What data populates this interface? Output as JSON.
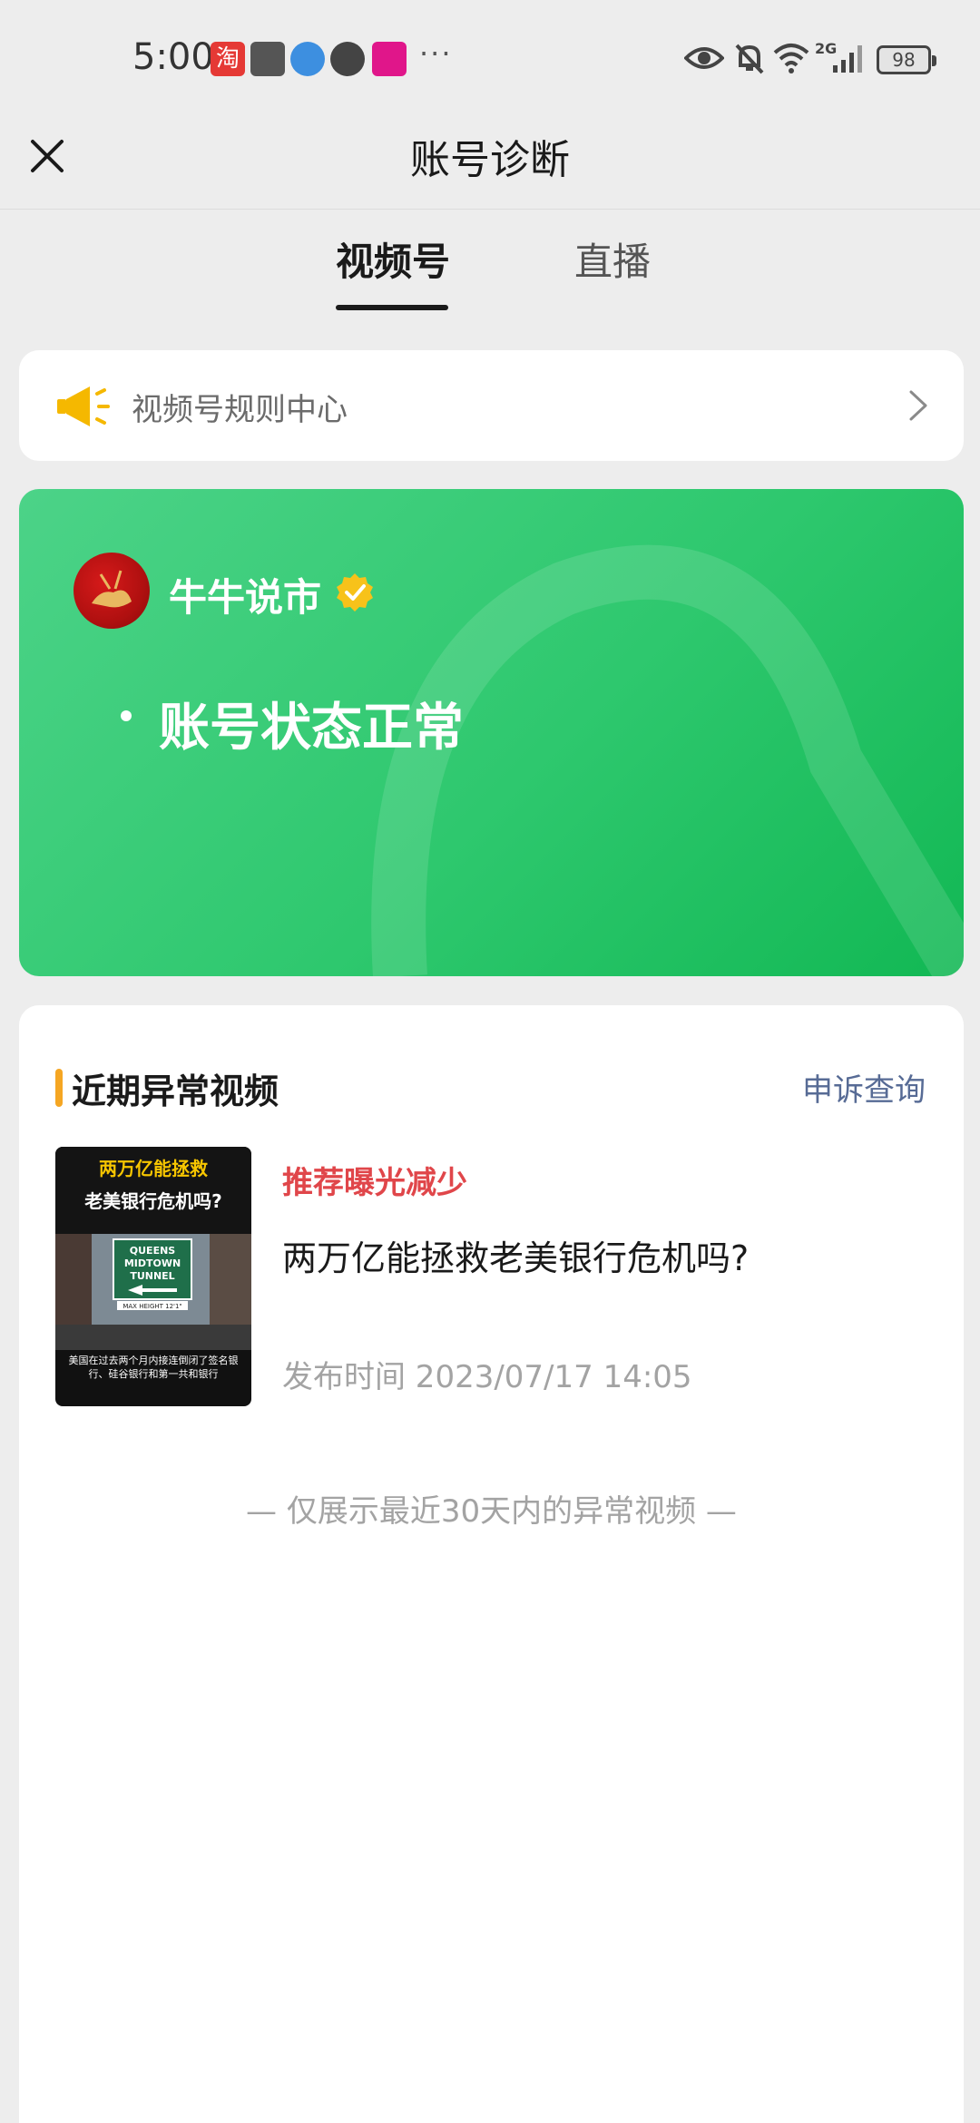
{
  "status_bar": {
    "time": "5:00",
    "more": "···",
    "battery": "98",
    "network": "2G",
    "app_icons": [
      "taobao-icon",
      "mail-icon",
      "browser-icon",
      "wechat-icon",
      "vipshop-icon"
    ],
    "right_icons": [
      "eye-icon",
      "bell-muted-icon",
      "wifi-icon",
      "signal-icon",
      "battery-icon"
    ]
  },
  "header": {
    "title": "账号诊断",
    "close_icon": "close-icon"
  },
  "tabs": [
    {
      "label": "视频号",
      "active": true
    },
    {
      "label": "直播",
      "active": false
    }
  ],
  "rules": {
    "label": "视频号规则中心",
    "icon": "megaphone-icon",
    "chevron": "chevron-right-icon"
  },
  "account": {
    "name": "牛牛说市",
    "status": "账号状态正常",
    "verified_icon": "verified-badge-icon"
  },
  "abnormal": {
    "title": "近期异常视频",
    "appeal": "申诉查询",
    "videos": [
      {
        "tag": "推荐曝光减少",
        "title": "两万亿能拯救老美银行危机吗?",
        "time": "发布时间 2023/07/17 14:05",
        "thumb_line1": "两万亿能拯救",
        "thumb_line2": "老美银行危机吗?",
        "thumb_sign1": "QUEENS",
        "thumb_sign2": "MIDTOWN",
        "thumb_sign3": "TUNNEL",
        "thumb_sign4": "MAX HEIGHT 12'1\"",
        "thumb_sub": "美国在过去两个月内接连倒闭了签名银行、硅谷银行和第一共和银行"
      }
    ],
    "footnote": "— 仅展示最近30天内的异常视频 —"
  },
  "colors": {
    "accent_green": "#2ec86e",
    "tag_red": "#e0464a",
    "link_blue": "#576b95",
    "section_bar": "#f5a623"
  }
}
